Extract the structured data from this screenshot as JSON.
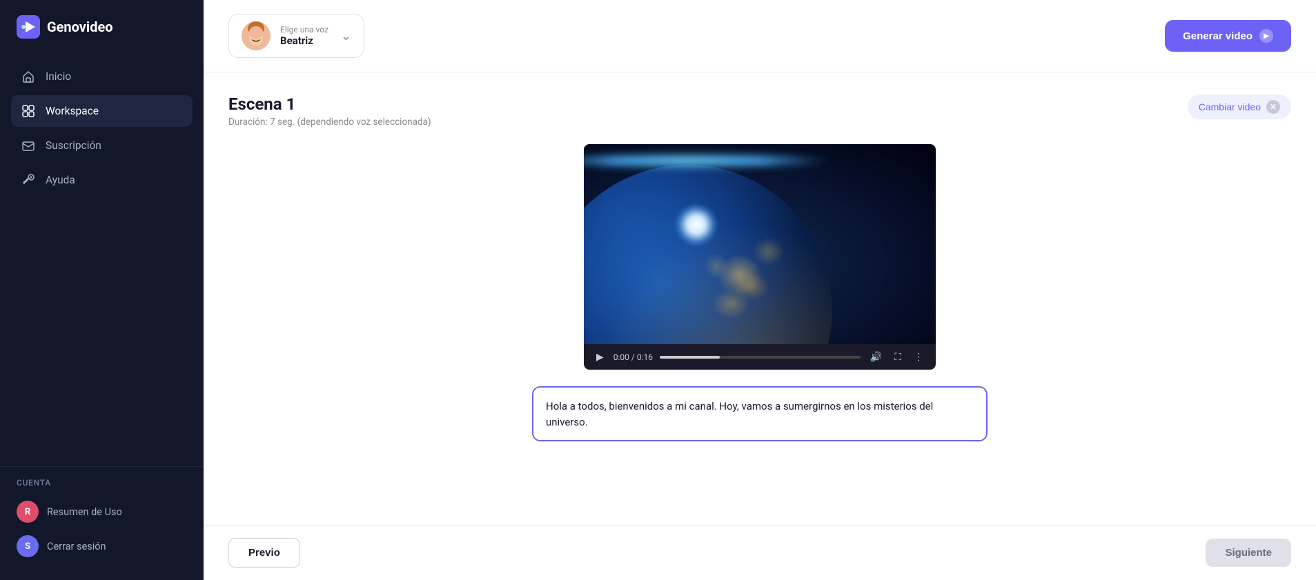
{
  "app": {
    "name": "Genovideo"
  },
  "sidebar": {
    "nav_items": [
      {
        "id": "inicio",
        "label": "Inicio",
        "icon": "home-icon"
      },
      {
        "id": "workspace",
        "label": "Workspace",
        "icon": "workspace-icon"
      },
      {
        "id": "suscripcion",
        "label": "Suscripción",
        "icon": "mail-icon"
      },
      {
        "id": "ayuda",
        "label": "Ayuda",
        "icon": "tools-icon"
      }
    ],
    "cuenta_label": "Cuenta",
    "bottom_items": [
      {
        "id": "resumen",
        "label": "Resumen de Uso",
        "avatar_letter": "R",
        "avatar_color": "#e04c6b"
      },
      {
        "id": "cerrar",
        "label": "Cerrar sesión",
        "avatar_letter": "S",
        "avatar_color": "#6b6bef"
      }
    ]
  },
  "topbar": {
    "voice_label": "Elige una voz",
    "voice_name": "Beatriz",
    "generate_button_label": "Generar video"
  },
  "scene": {
    "title": "Escena 1",
    "duration_text": "Duración: 7 seg. (dependiendo voz seleccionada)",
    "change_video_label": "Cambiar video",
    "video_time": "0:00 / 0:16",
    "script_text": "Hola a todos, bienvenidos a mi canal. Hoy, vamos a sumergirnos en los misterios del universo."
  },
  "footer": {
    "prev_label": "Previo",
    "next_label": "Siguiente"
  }
}
